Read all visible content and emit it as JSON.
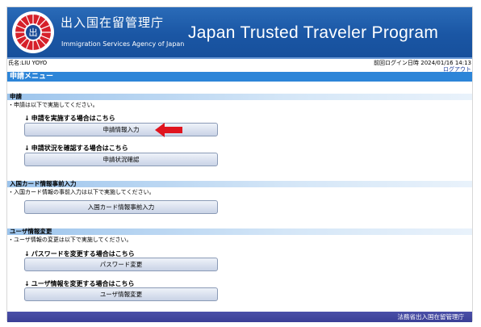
{
  "header": {
    "agency_name_jp": "出入国在留管理庁",
    "agency_name_en": "Immigration Services Agency of Japan",
    "program_title": "Japan Trusted Traveler Program",
    "logo_glyph": "出"
  },
  "user_bar": {
    "user_name": "氏名:LIU YOYO",
    "last_login": "前回ログイン日時 2024/01/16 14:13",
    "logout": "ログアウト"
  },
  "menu_title": "申請メニュー",
  "sections": {
    "application": {
      "title": "申請",
      "note": "・申請は以下で実施してください。",
      "sub1": "申請を実施する場合はこちら",
      "button1": "申請情報入力",
      "sub2": "申請状況を確認する場合はこちら",
      "button2": "申請状況確認"
    },
    "entry_card": {
      "title": "入国カード情報事前入力",
      "note": "・入国カード情報の事前入力は以下で実施してください。",
      "button": "入国カード情報事前入力"
    },
    "user_info": {
      "title": "ユーザ情報変更",
      "note": "・ユーザ情報の変更は以下で実施してください。",
      "sub1": "パスワードを変更する場合はこちら",
      "button1": "パスワード変更",
      "sub2": "ユーザ情報を変更する場合はこちら",
      "button2": "ユーザ情報変更"
    }
  },
  "arrow_glyph": "↓",
  "footer": "法務省出入国在留管理庁",
  "colors": {
    "header_blue": "#1a56a4",
    "menu_bar_blue": "#2d85d8",
    "footer_indigo": "#3a3f96",
    "pointer_red": "#e0141e"
  },
  "icons": [
    "agency-emblem-icon",
    "down-arrow-icon",
    "red-pointer-arrow-icon"
  ]
}
